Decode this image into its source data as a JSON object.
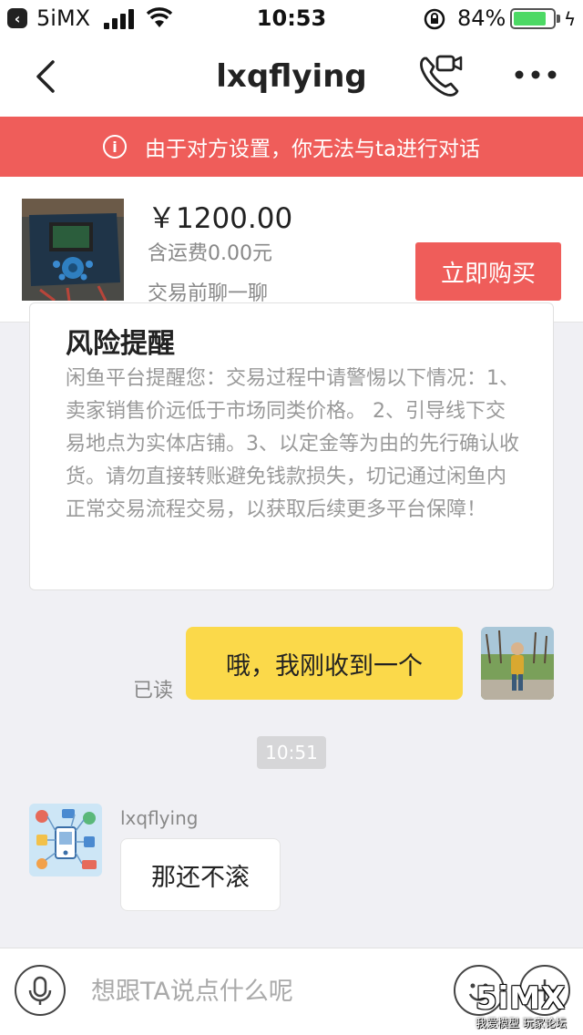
{
  "status_bar": {
    "back_app": "5iMX",
    "time": "10:53",
    "battery_percent": "84%",
    "battery_level": 0.84
  },
  "nav": {
    "title": "lxqflying",
    "back_icon": "chevron-left-icon",
    "call_icon": "phone-video-icon",
    "more_icon": "more-dots-icon"
  },
  "banner": {
    "icon": "info-icon",
    "text": "由于对方设置，你无法与ta进行对话",
    "color": "#ef5d5a"
  },
  "product": {
    "price": "￥1200.00",
    "shipping": "含运费0.00元",
    "chat_hint": "交易前聊一聊",
    "buy_label": "立即购买"
  },
  "risk_notice": {
    "title": "风险提醒",
    "body": "闲鱼平台提醒您：交易过程中请警惕以下情况：1、卖家销售价远低于市场同类价格。 2、引导线下交易地点为实体店铺。3、以定金等为由的先行确认收货。请勿直接转账避免钱款损失，切记通过闲鱼内正常交易流程交易，以获取后续更多平台保障！"
  },
  "messages": {
    "mine": {
      "text": "哦，我刚收到一个",
      "status": "已读",
      "bubble_color": "#fbd94a"
    },
    "timestamp": "10:51",
    "theirs": {
      "sender": "lxqflying",
      "text": "那还不滚"
    }
  },
  "input_bar": {
    "placeholder": "想跟TA说点什么呢",
    "value": "",
    "voice_icon": "microphone-icon",
    "emoji_icon": "emoji-icon",
    "plus_icon": "plus-icon"
  },
  "watermark": {
    "logo": "5iMX",
    "tagline": "我爱模型 玩家论坛"
  }
}
